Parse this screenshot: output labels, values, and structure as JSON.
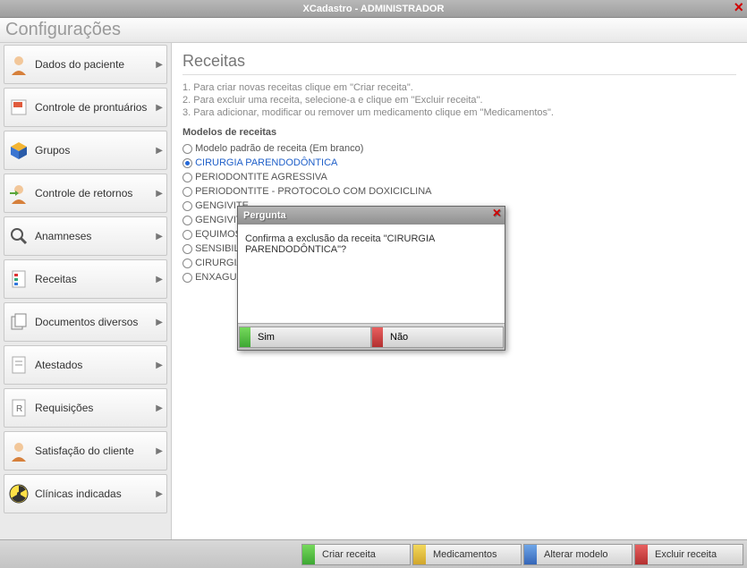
{
  "titlebar": {
    "title": "XCadastro - ADMINISTRADOR"
  },
  "header": {
    "title": "Configurações"
  },
  "sidebar": {
    "items": [
      {
        "label": "Dados do paciente",
        "icon": "person"
      },
      {
        "label": "Controle de prontuários",
        "icon": "docred"
      },
      {
        "label": "Grupos",
        "icon": "cube"
      },
      {
        "label": "Controle de retornos",
        "icon": "personarrow"
      },
      {
        "label": "Anamneses",
        "icon": "magnifier"
      },
      {
        "label": "Receitas",
        "icon": "recipe"
      },
      {
        "label": "Documentos diversos",
        "icon": "docs"
      },
      {
        "label": "Atestados",
        "icon": "cert"
      },
      {
        "label": "Requisições",
        "icon": "req"
      },
      {
        "label": "Satisfação do cliente",
        "icon": "person"
      },
      {
        "label": "Clínicas indicadas",
        "icon": "radiation"
      }
    ]
  },
  "main": {
    "title": "Receitas",
    "instructions": [
      "1. Para criar novas receitas clique em \"Criar receita\".",
      "2. Para excluir uma receita, selecione-a e clique em \"Excluir receita\".",
      "3. Para adicionar, modificar ou remover um medicamento clique em \"Medicamentos\"."
    ],
    "subhead": "Modelos de receitas",
    "recipes": [
      {
        "label": "Modelo padrão de receita (Em branco)",
        "selected": false
      },
      {
        "label": "CIRURGIA PARENDODÔNTICA",
        "selected": true
      },
      {
        "label": "PERIODONTITE AGRESSIVA",
        "selected": false
      },
      {
        "label": "PERIODONTITE - PROTOCOLO COM DOXICICLINA",
        "selected": false
      },
      {
        "label": "GENGIVITE",
        "selected": false
      },
      {
        "label": "GENGIVITE",
        "selected": false
      },
      {
        "label": "EQUIMOSE",
        "selected": false
      },
      {
        "label": "SENSIBILID",
        "selected": false
      },
      {
        "label": "CIRURGIA P",
        "selected": false
      },
      {
        "label": "ENXAGUAT",
        "selected": false
      }
    ]
  },
  "footer": {
    "buttons": [
      {
        "label": "Criar receita",
        "color": "green"
      },
      {
        "label": "Medicamentos",
        "color": "yellow"
      },
      {
        "label": "Alterar modelo",
        "color": "blue"
      },
      {
        "label": "Excluir receita",
        "color": "red"
      }
    ]
  },
  "modal": {
    "title": "Pergunta",
    "message": "Confirma a exclusão da receita \"CIRURGIA PARENDODÔNTICA\"?",
    "yes": "Sim",
    "no": "Não"
  }
}
